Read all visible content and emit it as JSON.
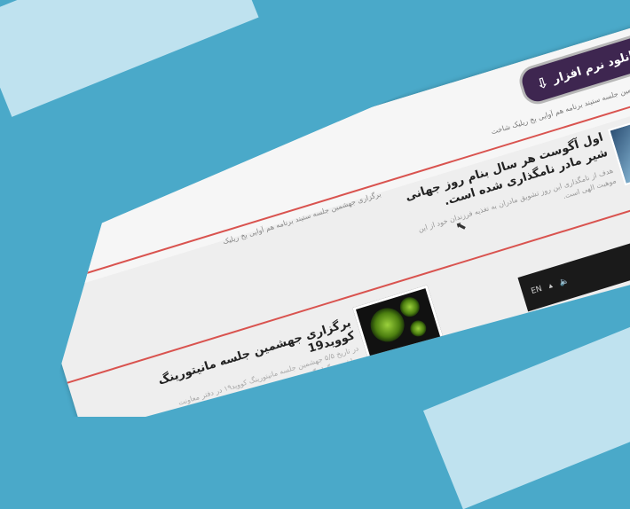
{
  "download_button": {
    "label": "دانلود نرم افزار"
  },
  "ticker_top": "برگزاری جهشمین جلسه ستیند برنامه هم آوایی بخ ریلیک شاخت",
  "ticker_mid": "برگزاری جهشمین جلسه ستیند برنامه هم آوایی بخ ریلیک",
  "news": [
    {
      "title": "اول آگوست هر سال بنام روز جهانی شیر مادر نامگذاری شده است.",
      "excerpt": "هدف از نامگذاری این روز تشویق مادران به تغذیه فرزندان خود از این موهبت الهی است."
    },
    {
      "title": "برگزاری جهشمین جلسه مانیتورینگ کووید19",
      "excerpt": "در تاریخ ۵/۵ جهشمین جلسه مانیتورینگ کووید۱۹ در دفتر معاونت بهداشت برگزار گردید."
    }
  ],
  "taskbar": {
    "lang": "EN"
  }
}
